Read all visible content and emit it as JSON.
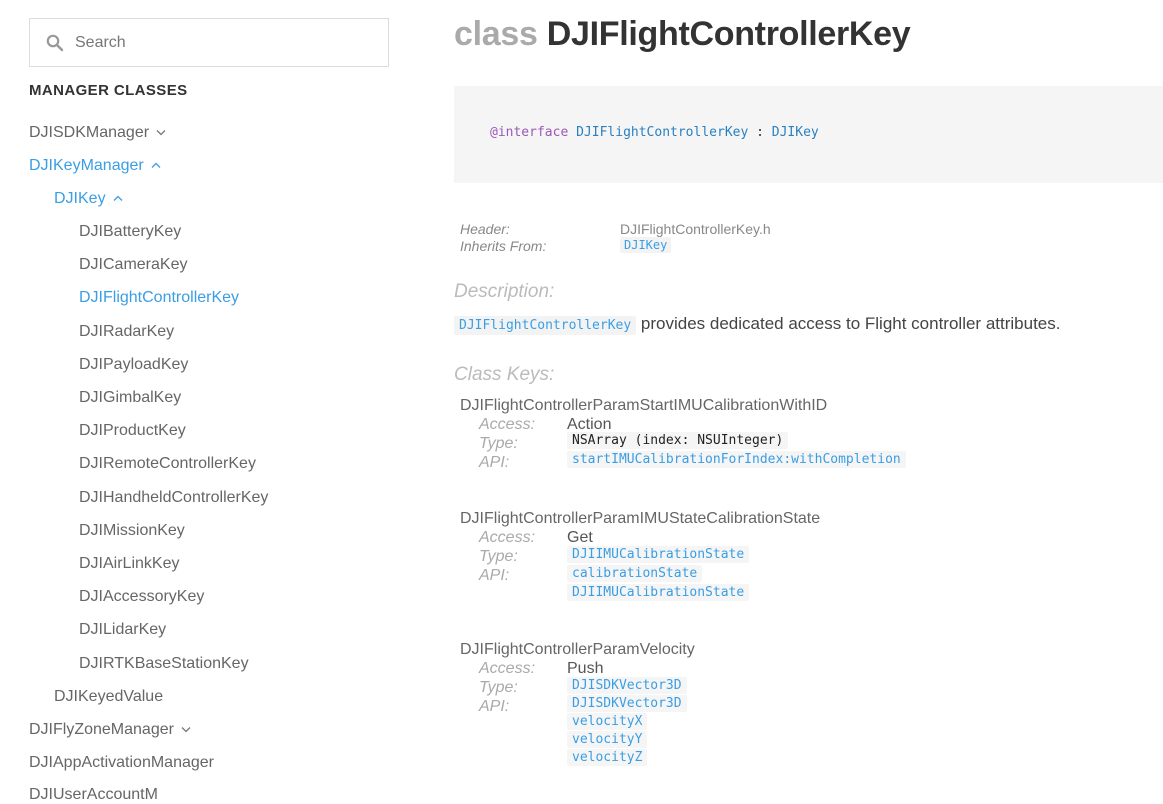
{
  "search": {
    "placeholder": "Search"
  },
  "sidebar": {
    "section_title": "MANAGER CLASSES",
    "items": [
      {
        "label": "DJISDKManager",
        "chevron": "down"
      },
      {
        "label": "DJIKeyManager",
        "chevron": "up"
      },
      {
        "label": "DJIKey",
        "chevron": "up"
      },
      {
        "label": "DJIBatteryKey"
      },
      {
        "label": "DJICameraKey"
      },
      {
        "label": "DJIFlightControllerKey"
      },
      {
        "label": "DJIRadarKey"
      },
      {
        "label": "DJIPayloadKey"
      },
      {
        "label": "DJIGimbalKey"
      },
      {
        "label": "DJIProductKey"
      },
      {
        "label": "DJIRemoteControllerKey"
      },
      {
        "label": "DJIHandheldControllerKey"
      },
      {
        "label": "DJIMissionKey"
      },
      {
        "label": "DJIAirLinkKey"
      },
      {
        "label": "DJIAccessoryKey"
      },
      {
        "label": "DJILidarKey"
      },
      {
        "label": "DJIRTKBaseStationKey"
      },
      {
        "label": "DJIKeyedValue"
      },
      {
        "label": "DJIFlyZoneManager",
        "chevron": "down"
      },
      {
        "label": "DJIAppActivationManager"
      },
      {
        "label": "DJIUserAccountM"
      }
    ]
  },
  "main": {
    "title_keyword": "class",
    "title_name": "DJIFlightControllerKey",
    "declaration": {
      "at": "@interface",
      "name": "DJIFlightControllerKey",
      "sep": ":",
      "parent": "DJIKey"
    },
    "header_label": "Header:",
    "header_value": "DJIFlightControllerKey.h",
    "inherits_label": "Inherits From:",
    "inherits_value": "DJIKey",
    "description_heading": "Description:",
    "description_code": "DJIFlightControllerKey",
    "description_text": "provides dedicated access to Flight controller attributes.",
    "class_keys_heading": "Class Keys:",
    "access_label": "Access:",
    "type_label": "Type:",
    "api_label": "API:",
    "keys": [
      {
        "name": "DJIFlightControllerParamStartIMUCalibrationWithID",
        "access": "Action",
        "type": "NSArray (index: NSUInteger)",
        "api": [
          "startIMUCalibrationForIndex:withCompletion"
        ]
      },
      {
        "name": "DJIFlightControllerParamIMUStateCalibrationState",
        "access": "Get",
        "type": "DJIIMUCalibrationState",
        "api": [
          "calibrationState",
          "DJIIMUCalibrationState"
        ]
      },
      {
        "name": "DJIFlightControllerParamVelocity",
        "access": "Push",
        "type": "DJISDKVector3D",
        "api": [
          "DJISDKVector3D",
          "velocityX",
          "velocityY",
          "velocityZ"
        ]
      }
    ]
  },
  "colors": {
    "link": "#3a9ee4",
    "text": "#444444",
    "muted": "#aaaaaa",
    "code_bg": "#f5f5f5"
  }
}
